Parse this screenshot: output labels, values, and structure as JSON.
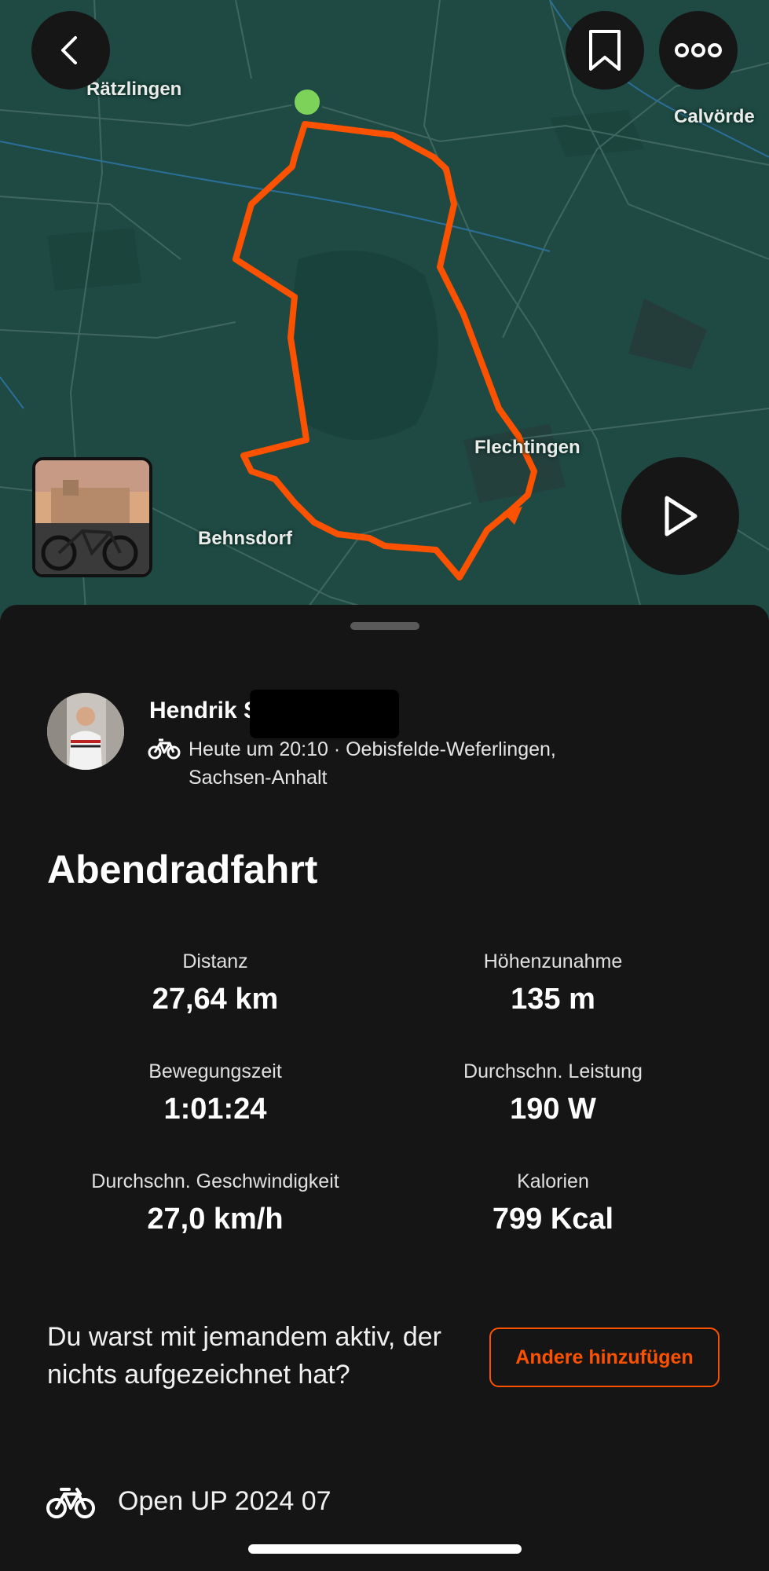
{
  "map": {
    "labels": {
      "raetzlingen": "Rätzlingen",
      "calvoerde": "Calvörde",
      "flechtingen": "Flechtingen",
      "behnsdorf": "Behnsdorf"
    },
    "route_color": "#fc5200",
    "start_color": "#7dd35a"
  },
  "header_buttons": {
    "back": "back-icon",
    "bookmark": "bookmark-icon",
    "more": "more-icon",
    "play": "play-icon"
  },
  "athlete": {
    "name": "Hendrik S",
    "meta": "Heute um 20:10 · Oebisfelde-Weferlingen, Sachsen-Anhalt"
  },
  "activity": {
    "title": "Abendradfahrt",
    "stats": [
      {
        "label": "Distanz",
        "value": "27,64 km"
      },
      {
        "label": "Höhenzunahme",
        "value": "135 m"
      },
      {
        "label": "Bewegungszeit",
        "value": "1:01:24"
      },
      {
        "label": "Durchschn. Leistung",
        "value": "190 W"
      },
      {
        "label": "Durchschn. Geschwindigkeit",
        "value": "27,0 km/h"
      },
      {
        "label": "Kalorien",
        "value": "799 Kcal"
      }
    ]
  },
  "group_prompt": {
    "text": "Du warst mit jemandem aktiv, der nichts aufgezeichnet hat?",
    "button": "Andere hinzufügen"
  },
  "gear": {
    "icon": "bike-icon",
    "name": "Open UP 2024 07"
  },
  "colors": {
    "accent": "#fc5200",
    "background": "#151515"
  }
}
